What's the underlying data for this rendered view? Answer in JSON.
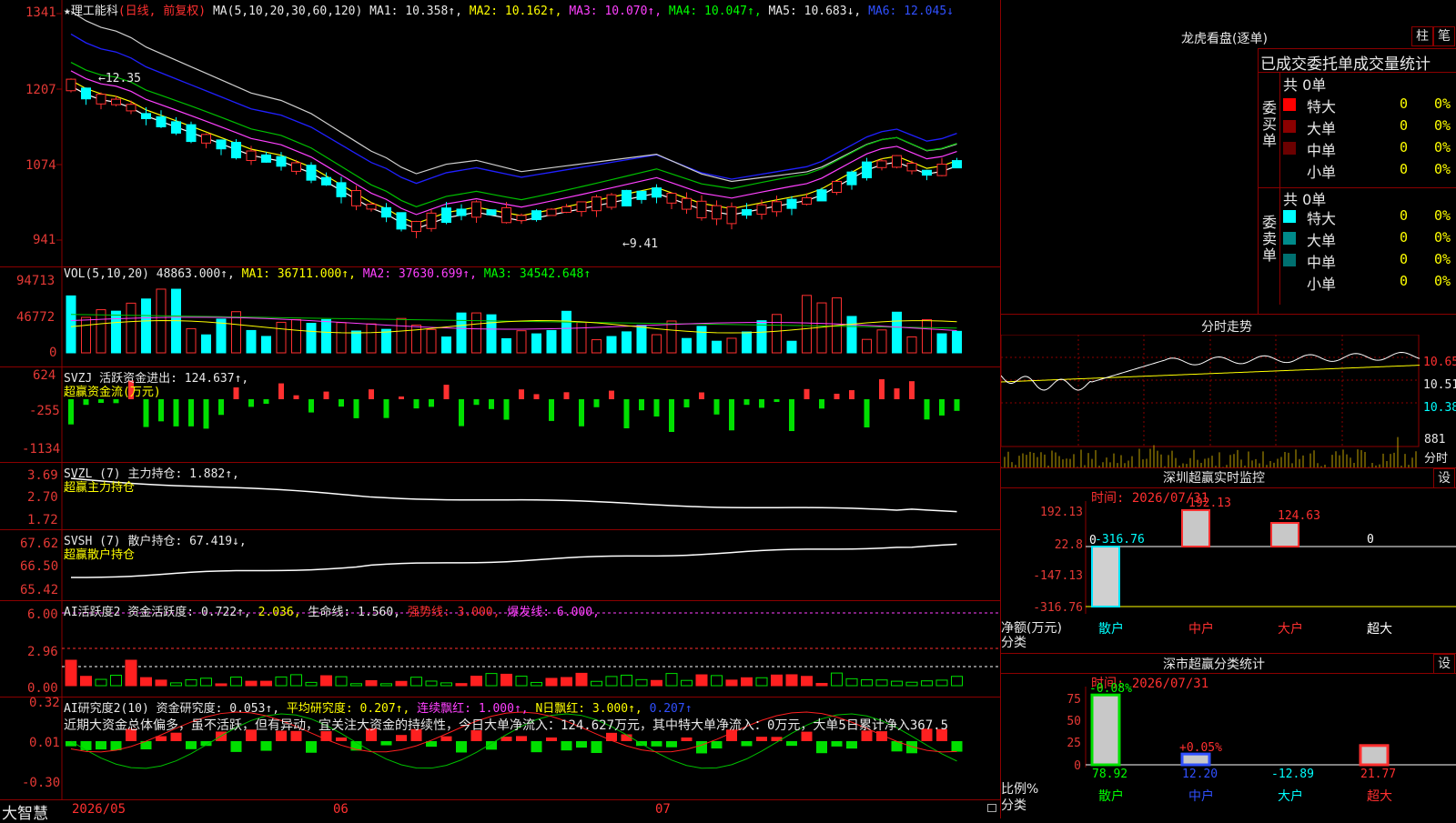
{
  "stock": {
    "header_title": "★理工能科",
    "header_mode": "(日线, 前复权)",
    "ma_label": "MA(5,10,20,30,60,120)",
    "ma1": "MA1: 10.358↑,",
    "ma2": "MA2: 10.162↑,",
    "ma3": "MA3: 10.070↑,",
    "ma4": "MA4: 10.047↑,",
    "ma5": "MA5: 10.683↓,",
    "ma6": "MA6: 12.045↓",
    "price_axis": [
      "1341",
      "1207",
      "1074",
      "941"
    ],
    "high_marker": "←12.35",
    "low_marker": "←9.41"
  },
  "volume": {
    "header": "VOL(5,10,20) 48863.000↑,",
    "ma1": "MA1: 36711.000↑,",
    "ma2": "MA2: 37630.699↑,",
    "ma3": "MA3: 34542.648↑",
    "axis": [
      "94713",
      "46772",
      "0"
    ]
  },
  "svzj": {
    "header": "SVZJ  活跃资金进出: 124.637↑,",
    "sub": "超赢资金流(万元)",
    "axis": [
      "624",
      "-255",
      "-1134"
    ]
  },
  "svzl": {
    "header": "SVZL (7) 主力持仓: 1.882↑,",
    "sub": "超赢主力持仓",
    "axis": [
      "3.69",
      "2.70",
      "1.72"
    ]
  },
  "svsh": {
    "header": "SVSH (7) 散户持仓: 67.419↓,",
    "sub": "超赢散户持仓",
    "axis": [
      "67.62",
      "66.50",
      "65.42"
    ]
  },
  "ai1": {
    "h1": "AI活跃度2 资金活跃度: 0.722↑,",
    "h2": "2.036,",
    "h3": "生命线: 1.560,",
    "h4": "强势线: 3.000,",
    "h5": "爆发线: 6.000,",
    "axis": [
      "6.00",
      "2.96",
      "0.00"
    ]
  },
  "ai2": {
    "h1": "AI研究度2(10) 资金研究度: 0.053↑,",
    "h2": "平均研究度: 0.207↑,",
    "h3": "连续飘红: 1.000↑,",
    "h4": "N日飘红: 3.000↑,",
    "h5": "0.207↑",
    "note": "近期大资金总体偏多，虽不活跃，但有异动，宜关注大资金的持续性，今日大单净流入：124.627万元，其中特大单净流入：0万元，大单5日累计净入367.5",
    "axis": [
      "0.32",
      "0.01",
      "-0.30"
    ]
  },
  "footer": {
    "brand": "大智慧",
    "dates": [
      "2026/05",
      "06",
      "07"
    ]
  },
  "dragon": {
    "title": "龙虎看盘(逐单)",
    "btn_bar": "柱",
    "btn_pen": "笔",
    "stats_title": "已成交委托单成交量统计",
    "buy_label": "委买单",
    "sell_label": "委卖单",
    "buy_total": "共 0单",
    "sell_total": "共 0单",
    "buy_rows": [
      {
        "name": "特大",
        "count": "0",
        "pct": "0%",
        "color": "#ff0000"
      },
      {
        "name": "大单",
        "count": "0",
        "pct": "0%",
        "color": "#8b0000"
      },
      {
        "name": "中单",
        "count": "0",
        "pct": "0%",
        "color": "#6b0000"
      },
      {
        "name": "小单",
        "count": "0",
        "pct": "0%",
        "color": "#000000"
      }
    ],
    "sell_rows": [
      {
        "name": "特大",
        "count": "0",
        "pct": "0%",
        "color": "#00ffff"
      },
      {
        "name": "大单",
        "count": "0",
        "pct": "0%",
        "color": "#008b8b"
      },
      {
        "name": "中单",
        "count": "0",
        "pct": "0%",
        "color": "#007070"
      },
      {
        "name": "小单",
        "count": "0",
        "pct": "0%",
        "color": "#000000"
      }
    ]
  },
  "intraday": {
    "title": "分时走势",
    "axis": [
      "10.65",
      "10.51",
      "10.38"
    ],
    "vol_label": "881",
    "vol_unit": "分时"
  },
  "monitor": {
    "title": "深圳超赢实时监控",
    "settings": "设",
    "time": "时间: 2026/07/31",
    "axis": [
      "192.13",
      "22.8",
      "-147.13",
      "-316.76"
    ],
    "zero_label": "0",
    "net_label": "净额(万元)",
    "class_label": "分类",
    "categories": [
      "散户",
      "中户",
      "大户",
      "超大"
    ],
    "values": [
      -316.76,
      192.13,
      124.63,
      0
    ],
    "value_labels": [
      "-316.76",
      "192.13",
      "124.63",
      "0"
    ]
  },
  "classify": {
    "title": "深市超赢分类统计",
    "settings": "设",
    "time": "时间: 2026/07/31",
    "axis": [
      "75",
      "50",
      "25",
      "0"
    ],
    "ratio_label": "比例%",
    "class_label": "分类",
    "categories": [
      "散户",
      "中户",
      "大户",
      "超大"
    ],
    "top_labels": [
      "-0.08%",
      "+0.05%",
      "",
      ""
    ],
    "values": [
      78.92,
      12.2,
      -12.89,
      21.77
    ],
    "value_labels": [
      "78.92",
      "12.20",
      "-12.89",
      "21.77"
    ]
  },
  "colors": {
    "up": "#ff3030",
    "down": "#00ffff",
    "grid": "#8b0000"
  }
}
